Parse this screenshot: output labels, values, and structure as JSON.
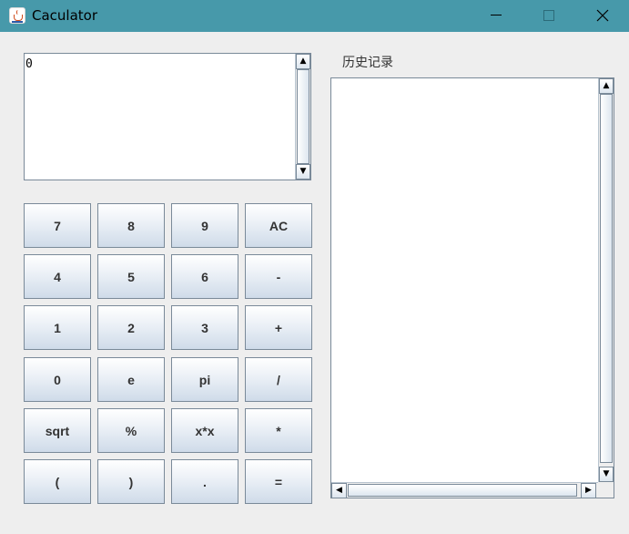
{
  "window": {
    "title": "Caculator"
  },
  "display": {
    "value": "0"
  },
  "keypad": {
    "keys": [
      "7",
      "8",
      "9",
      "AC",
      "4",
      "5",
      "6",
      "-",
      "1",
      "2",
      "3",
      "+",
      "0",
      "e",
      "pi",
      "/",
      "sqrt",
      "%",
      "x*x",
      "*",
      "(",
      ")",
      ".",
      "="
    ]
  },
  "history": {
    "label": "历史记录"
  },
  "icons": {
    "scroll_up": "▲",
    "scroll_down": "▼",
    "scroll_left": "◀",
    "scroll_right": "▶"
  },
  "colors": {
    "titlebar": "#4799aa",
    "background": "#eeeeee"
  }
}
